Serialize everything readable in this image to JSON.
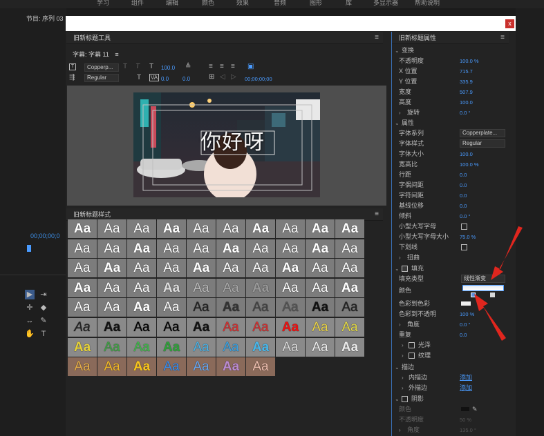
{
  "app": {
    "sequence_tab": "节目: 序列 03",
    "timecode": "00;00;00;0",
    "top_menu": [
      "学习",
      "组件",
      "编辑",
      "颜色",
      "效果",
      "音频",
      "图形",
      "库",
      "多显示器",
      "帮助说明"
    ]
  },
  "dialog": {
    "close_label": "x"
  },
  "tools_panel": {
    "title": "旧新标题工具",
    "subtitle_label": "字幕: 字幕 11",
    "font_family": "Copperp...",
    "font_style": "Regular",
    "font_size": "100.0",
    "kerning": "0.0",
    "leading": "0.0",
    "timecode": "00;00;00;00"
  },
  "preview": {
    "text": "你好呀"
  },
  "styles_panel": {
    "title": "旧新标题样式",
    "swatch_label": "Aa"
  },
  "properties": {
    "title": "旧新标题属性",
    "transform": {
      "heading": "变换",
      "opacity_label": "不透明度",
      "opacity": "100.0 %",
      "xpos_label": "X 位置",
      "xpos": "715.7",
      "ypos_label": "Y 位置",
      "ypos": "335.9",
      "width_label": "宽度",
      "width": "507.9",
      "height_label": "高度",
      "height": "100.0",
      "rotation_label": "旋转",
      "rotation": "0.0 °"
    },
    "attributes": {
      "heading": "属性",
      "font_family_label": "字体系列",
      "font_family": "Copperplate...",
      "font_style_label": "字体样式",
      "font_style": "Regular",
      "font_size_label": "字体大小",
      "font_size": "100.0",
      "aspect_label": "宽高比",
      "aspect": "100.0 %",
      "leading_label": "行距",
      "leading": "0.0",
      "kerning_label": "字偶间距",
      "kerning": "0.0",
      "tracking_label": "字符间距",
      "tracking": "0.0",
      "baseline_label": "基线位移",
      "baseline": "0.0",
      "slant_label": "倾斜",
      "slant": "0.0 °",
      "smallcaps_label": "小型大写字母",
      "smallcaps_size_label": "小型大写字母大小",
      "smallcaps_size": "75.0 %",
      "underline_label": "下划线",
      "distort_label": "扭曲"
    },
    "fill": {
      "heading": "填充",
      "fill_type_label": "填充类型",
      "fill_type": "线性渐变",
      "color_label": "颜色",
      "color_stop_label": "色彩到色彩",
      "color_stop_opacity_label": "色彩到不透明",
      "color_stop_opacity": "100 %",
      "angle_label": "角度",
      "angle": "0.0 °",
      "repeat_label": "重复",
      "repeat": "0.0",
      "sheen_label": "光泽",
      "texture_label": "纹理"
    },
    "strokes": {
      "heading": "描边",
      "inner_label": "内描边",
      "inner_add": "添加",
      "outer_label": "外描边",
      "outer_add": "添加"
    },
    "shadow": {
      "heading": "阴影",
      "color_label": "颜色",
      "opacity_label": "不透明度",
      "opacity": "50 %",
      "angle_label": "角度",
      "angle": "135.0 °"
    }
  }
}
